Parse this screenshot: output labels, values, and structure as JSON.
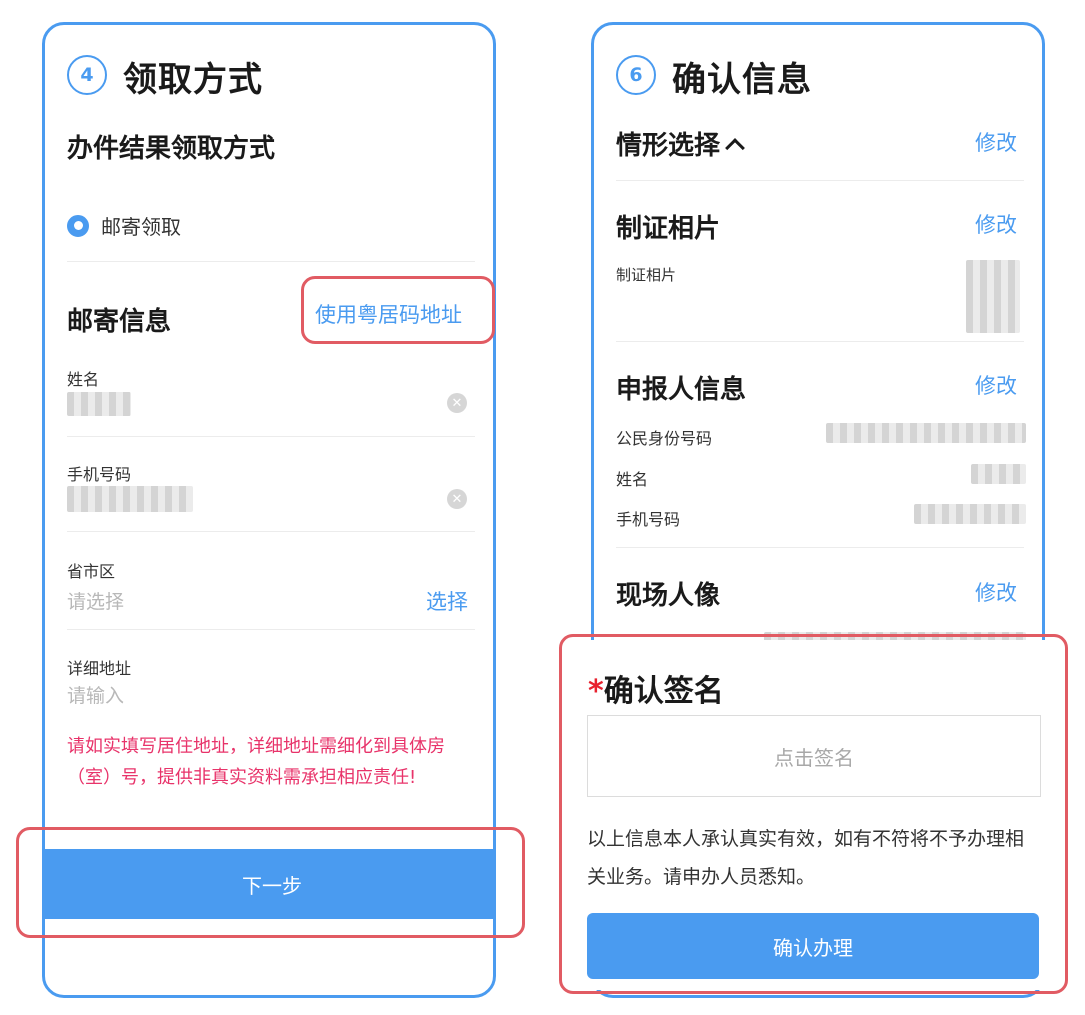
{
  "left": {
    "step_number": "4",
    "step_title": "领取方式",
    "pickup_section_title": "办件结果领取方式",
    "pickup_option": "邮寄领取",
    "mail_section_title": "邮寄信息",
    "use_address_link": "使用粤居码地址",
    "name_label": "姓名",
    "phone_label": "手机号码",
    "region_label": "省市区",
    "region_placeholder": "请选择",
    "region_select_link": "选择",
    "address_label": "详细地址",
    "address_placeholder": "请输入",
    "warning_text": "请如实填写居住地址，详细地址需细化到具体房（室）号，提供非真实资料需承担相应责任!",
    "next_button": "下一步"
  },
  "right": {
    "step_number": "6",
    "step_title": "确认信息",
    "situation_title": "情形选择",
    "modify_label": "修改",
    "photo_section_title": "制证相片",
    "photo_label": "制证相片",
    "applicant_section_title": "申报人信息",
    "id_label": "公民身份号码",
    "name_label": "姓名",
    "phone_label": "手机号码",
    "portrait_section_title": "现场人像",
    "signature_required_mark": "*",
    "signature_title": "确认签名",
    "signature_placeholder": "点击签名",
    "disclaimer": "以上信息本人承认真实有效，如有不符将不予办理相关业务。请申办人员悉知。",
    "confirm_button": "确认办理"
  },
  "colors": {
    "accent": "#4a9bf0",
    "highlight": "#e15b63",
    "warning": "#e8336a"
  }
}
